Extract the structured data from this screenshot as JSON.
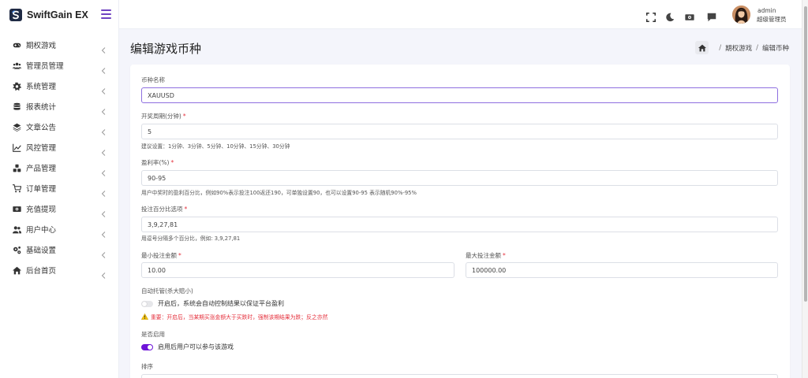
{
  "brand": {
    "name": "SwiftGain EX"
  },
  "sidebar": {
    "items": [
      {
        "label": "期权游戏",
        "icon": "gamepad-icon"
      },
      {
        "label": "管理员管理",
        "icon": "users-icon"
      },
      {
        "label": "系统管理",
        "icon": "gear-icon"
      },
      {
        "label": "报表统计",
        "icon": "database-icon"
      },
      {
        "label": "文章公告",
        "icon": "layers-icon"
      },
      {
        "label": "风控管理",
        "icon": "line-chart-icon"
      },
      {
        "label": "产品管理",
        "icon": "cubes-icon"
      },
      {
        "label": "订单管理",
        "icon": "cart-icon"
      },
      {
        "label": "充值提现",
        "icon": "money-icon"
      },
      {
        "label": "用户中心",
        "icon": "user-group-icon"
      },
      {
        "label": "基础设置",
        "icon": "cogs-icon"
      },
      {
        "label": "后台首页",
        "icon": "home-icon"
      }
    ]
  },
  "topbar": {
    "user_name": "admin",
    "user_role": "超级管理员"
  },
  "page": {
    "title": "编辑游戏币种",
    "breadcrumb": [
      "期权游戏",
      "编辑币种"
    ]
  },
  "form": {
    "currency_name": {
      "label": "币种名称",
      "value": "XAUUSD"
    },
    "period": {
      "label": "开奖周期(分钟)",
      "required": "*",
      "value": "5",
      "help": "建议设置：1分钟、3分钟、5分钟、10分钟、15分钟、30分钟"
    },
    "profit_rate": {
      "label": "盈利率(%)",
      "required": "*",
      "value": "90-95",
      "help": "用户中奖时的盈利百分比，例如90%表示投注100返还190，可单独设置90，也可以设置90-95 表示随机90%-95%"
    },
    "bet_percent": {
      "label": "投注百分比选项",
      "required": "*",
      "value": "3,9,27,81",
      "help": "用逗号分隔多个百分比，例如: 3,9,27,81"
    },
    "min_bet": {
      "label": "最小投注金额",
      "required": "*",
      "value": "10.00"
    },
    "max_bet": {
      "label": "最大投注金额",
      "required": "*",
      "value": "100000.00"
    },
    "auto_control": {
      "label": "自动托管(杀大赔小)",
      "toggle_text": "开启后，系统会自动控制结果以保证平台盈利",
      "enabled": false,
      "warning": "重要：开启后，当某期买涨金额大于买跌时，强制该期结果为跌；反之亦然"
    },
    "enabled": {
      "label": "是否启用",
      "toggle_text": "启用后用户可以参与该游戏",
      "enabled": true
    },
    "sort": {
      "label": "排序"
    }
  },
  "colors": {
    "accent": "#6e14d8",
    "danger": "#e5323e",
    "focus_border": "#8e6fe0"
  }
}
